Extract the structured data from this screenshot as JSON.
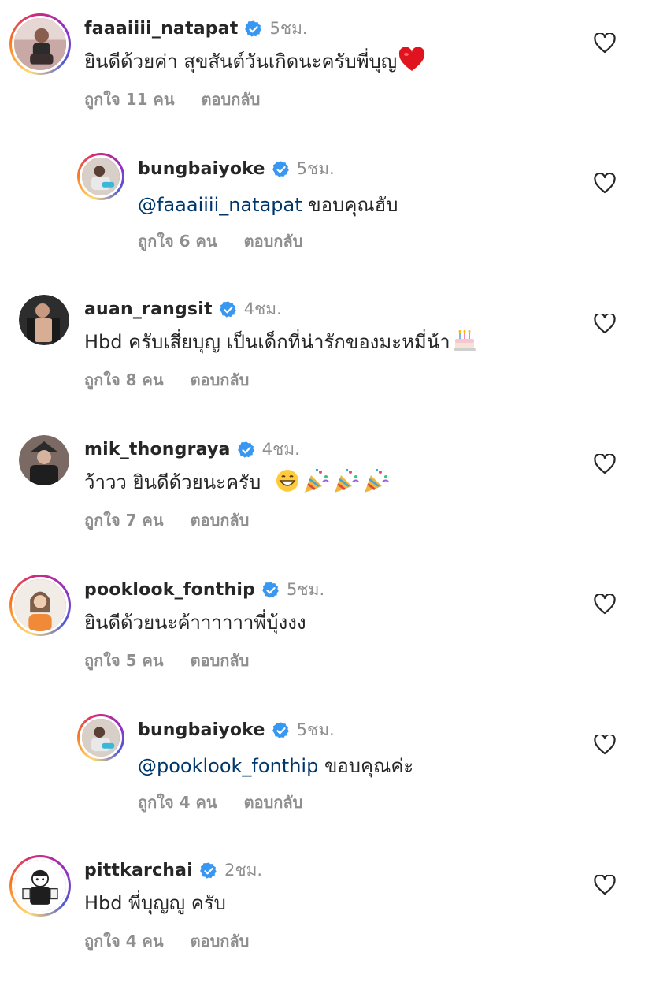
{
  "comments": [
    {
      "username": "faaaiiii_natapat",
      "time": "5ชม.",
      "text": "ยินดีด้วยค่า สุขสันต์วันเกิดนะครับพี่บุญ",
      "likes": "ถูกใจ 11 คน",
      "reply": "ตอบกลับ",
      "emoji": "red-heart"
    },
    {
      "username": "bungbaiyoke",
      "time": "5ชม.",
      "mention": "@faaaiiii_natapat",
      "text": " ขอบคุณฮับ",
      "likes": "ถูกใจ 6 คน",
      "reply": "ตอบกลับ"
    },
    {
      "username": "auan_rangsit",
      "time": "4ชม.",
      "text": "Hbd ครับเสี่ยบุญ เป็นเด็กที่น่ารักของมะหมี่น้า",
      "likes": "ถูกใจ 8 คน",
      "reply": "ตอบกลับ",
      "emoji": "birthday-cake"
    },
    {
      "username": "mik_thongraya",
      "time": "4ชม.",
      "text": "ว้าวว ยินดีด้วยนะครับ",
      "likes": "ถูกใจ 7 คน",
      "reply": "ตอบกลับ",
      "emoji": "grin-party-popper-x3"
    },
    {
      "username": "pooklook_fonthip",
      "time": "5ชม.",
      "text": "ยินดีด้วยนะค้าาาาาาพี่บุ้งงง",
      "likes": "ถูกใจ 5 คน",
      "reply": "ตอบกลับ"
    },
    {
      "username": "bungbaiyoke",
      "time": "5ชม.",
      "mention": "@pooklook_fonthip",
      "text": " ขอบคุณค่ะ",
      "likes": "ถูกใจ 4 คน",
      "reply": "ตอบกลับ"
    },
    {
      "username": "pittkarchai",
      "time": "2ชม.",
      "text": "Hbd พี่บุญญู ครับ",
      "likes": "ถูกใจ 4 คน",
      "reply": "ตอบกลับ"
    }
  ],
  "colors": {
    "verified": "#3897f0",
    "mention": "#00376b",
    "muted": "#8e8e8e",
    "text": "#262626"
  },
  "icons": {
    "like": "heart-outline-icon",
    "verified": "verified-badge-icon"
  }
}
